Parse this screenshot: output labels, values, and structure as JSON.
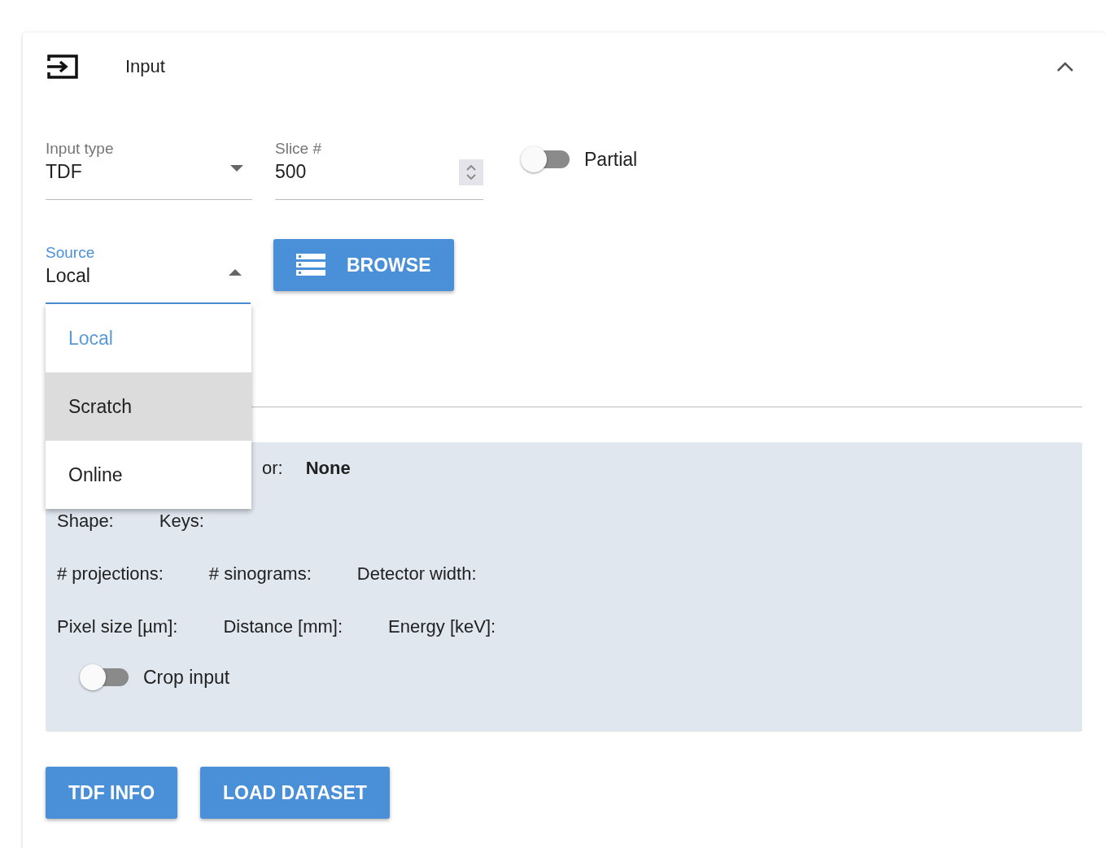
{
  "panel": {
    "title": "Input",
    "expanded": true
  },
  "fields": [
    {
      "kind": "select",
      "label": "Input type",
      "value": "TDF"
    },
    {
      "kind": "number",
      "label": "Slice #",
      "value": "500"
    }
  ],
  "partial_toggle": {
    "label": "Partial",
    "on": false
  },
  "source": {
    "label": "Source",
    "value": "Local",
    "open": true,
    "options": [
      {
        "label": "Local",
        "selected": true,
        "highlighted": false
      },
      {
        "label": "Scratch",
        "selected": false,
        "highlighted": true
      },
      {
        "label": "Online",
        "selected": false,
        "highlighted": false
      }
    ]
  },
  "browse_button": "BROWSE",
  "info": {
    "detector": {
      "label": "or:",
      "value": "None"
    },
    "rows": [
      [
        {
          "label": "Shape:"
        },
        {
          "label": "Keys:"
        }
      ],
      [
        {
          "label": "# projections:"
        },
        {
          "label": "# sinograms:"
        },
        {
          "label": "Detector width:"
        }
      ],
      [
        {
          "label": "Pixel size [µm]:"
        },
        {
          "label": "Distance [mm]:"
        },
        {
          "label": "Energy [keV]:"
        }
      ]
    ],
    "crop_toggle": {
      "label": "Crop input",
      "on": false
    }
  },
  "buttons": [
    "TDF INFO",
    "LOAD DATASET"
  ]
}
